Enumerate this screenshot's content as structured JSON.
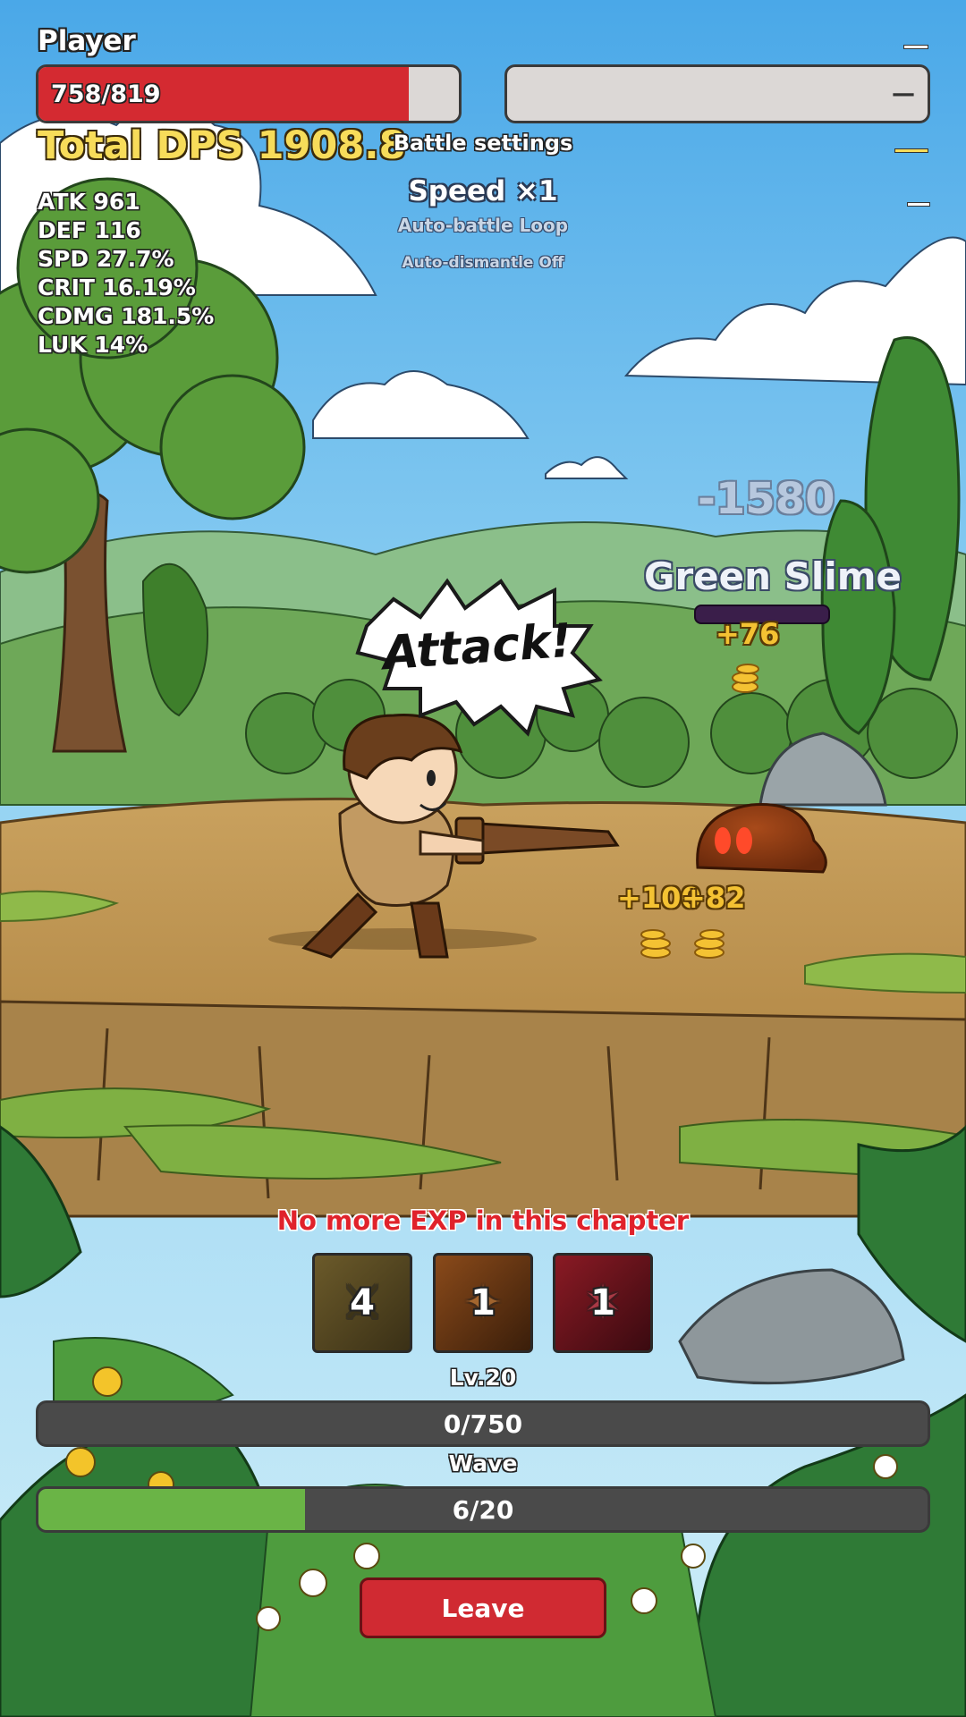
{
  "player": {
    "label": "Player",
    "hp_text": "758/819",
    "hp_fraction": 0.88,
    "hp_color": "#d42a31"
  },
  "enemy_bar": {
    "label": "—"
  },
  "stats": {
    "total_dps": "Total DPS 1908.8",
    "lines": [
      "ATK 961",
      "DEF 116",
      "SPD 27.7%",
      "CRIT 16.19%",
      "CDMG 181.5%",
      "LUK 14%"
    ]
  },
  "battle_settings": {
    "title": "Battle settings",
    "speed": "Speed ×1",
    "auto_battle": "Auto-battle Loop",
    "auto_dismantle": "Auto-dismantle Off"
  },
  "combat": {
    "damage_number": "-1580",
    "enemy_name": "Green Slime",
    "speech": "Attack!",
    "gold_popups": [
      "+76",
      "+100",
      "+82"
    ]
  },
  "notice": "No more EXP in this chapter",
  "skills": [
    {
      "count": "4",
      "icon": "sword-slash-icon"
    },
    {
      "count": "1",
      "icon": "warrior-strike-icon"
    },
    {
      "count": "1",
      "icon": "blood-slash-icon"
    }
  ],
  "level": {
    "label": "Lv.20",
    "exp_text": "0/750",
    "exp_fraction": 0
  },
  "wave": {
    "label": "Wave",
    "progress_text": "6/20",
    "fraction": 0.3,
    "color": "#6ab446"
  },
  "leave_label": "Leave",
  "colors": {
    "dps_yellow": "#f7dc5a",
    "notice_red": "#e0222b",
    "gold": "#f4c233"
  }
}
